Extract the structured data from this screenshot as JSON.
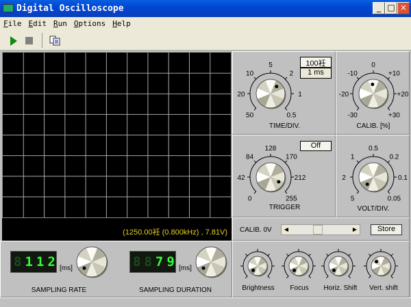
{
  "window": {
    "title": "Digital Oscilloscope",
    "minimize": "_",
    "maximize": "□",
    "close": "×"
  },
  "menu": [
    "File",
    "Edit",
    "Run",
    "Options",
    "Help"
  ],
  "toolbar": {
    "icons": [
      "play-icon",
      "stop-icon",
      "copy-icon"
    ]
  },
  "scope": {
    "readout": "(1250.00衽 (0.800kHz) , 7.81V)",
    "grid_cols": 11,
    "grid_rows": 8
  },
  "time_div": {
    "label": "TIME/DIV.",
    "scale": [
      "50",
      "20",
      "10",
      "5",
      "2",
      "1",
      "0.5"
    ],
    "display_top": "100衽",
    "display_bottom": "1 ms"
  },
  "calib_pct": {
    "label": "CALIB. [%]",
    "scale": [
      "-30",
      "-20",
      "-10",
      "0",
      "+10",
      "+20",
      "+30"
    ]
  },
  "trigger": {
    "label": "TRIGGER",
    "scale": [
      "0",
      "42",
      "84",
      "128",
      "170",
      "212",
      "255"
    ],
    "button": "Off"
  },
  "volt_div": {
    "label": "VOLT/DIV.",
    "scale": [
      "5",
      "2",
      "1",
      "0.5",
      "0.2",
      "0.1",
      "0.05"
    ]
  },
  "calib_0v": {
    "label": "CALIB. 0V",
    "slider_value_pct": 45,
    "store": "Store"
  },
  "sampling_rate": {
    "label": "SAMPLING RATE",
    "value": "112",
    "unit": "[ms]"
  },
  "sampling_duration": {
    "label": "SAMPLING DURATION",
    "value": "79",
    "unit": "[ms]"
  },
  "small_knobs": [
    {
      "label": "Brightness"
    },
    {
      "label": "Focus"
    },
    {
      "label": "Horiz. Shift"
    },
    {
      "label": "Vert. shift"
    }
  ],
  "colors": {
    "title_bar": "#0046d5",
    "readout": "#e8d020",
    "lcd_on": "#33ff33"
  }
}
